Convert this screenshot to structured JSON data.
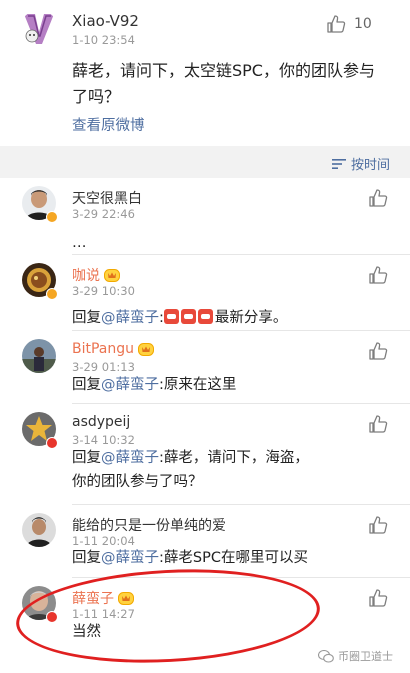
{
  "post": {
    "author": "Xiao-V92",
    "time": "1-10 23:54",
    "like_count": "10",
    "text": "薛老，请问下，太空链SPC，你的团队参与了吗？",
    "view_original": "查看原微博"
  },
  "sort": {
    "label": "按时间",
    "icon": "sort-lines-icon"
  },
  "comments": [
    {
      "name": "天空很黑白",
      "time": "3-29 22:46",
      "text": "…",
      "vip": true,
      "crown": false
    },
    {
      "name": "咖说",
      "time": "3-29 10:30",
      "reply_prefix": "回复",
      "mention": "@薛蛮子",
      "text_after": "最新分享。",
      "emoji_count": 3,
      "vip": true,
      "crown": true
    },
    {
      "name": "BitPangu",
      "time": "3-29 01:13",
      "reply_prefix": "回复",
      "mention": "@薛蛮子",
      "text_after": ":原来在这里",
      "vip": false,
      "crown": true
    },
    {
      "name": "asdypeij",
      "time": "3-14 10:32",
      "reply_prefix": "回复",
      "mention": "@薛蛮子",
      "text_after": ":薛老，请问下，海盗，你的团队参与了吗？",
      "vip": true,
      "crown": false
    },
    {
      "name": "能给的只是一份单纯的爱",
      "time": "1-11 20:04",
      "reply_prefix": "回复",
      "mention": "@薛蛮子",
      "text_after": ":薛老SPC在哪里可以买",
      "vip": false,
      "crown": false
    },
    {
      "name": "薛蛮子",
      "time": "1-11 14:27",
      "text": "当然",
      "vip": true,
      "crown": true
    }
  ],
  "watermark": {
    "text": "币圈卫道士"
  },
  "colors": {
    "link": "#4e6ea0",
    "vip_name": "#eb7350",
    "highlight": "#e02020"
  }
}
